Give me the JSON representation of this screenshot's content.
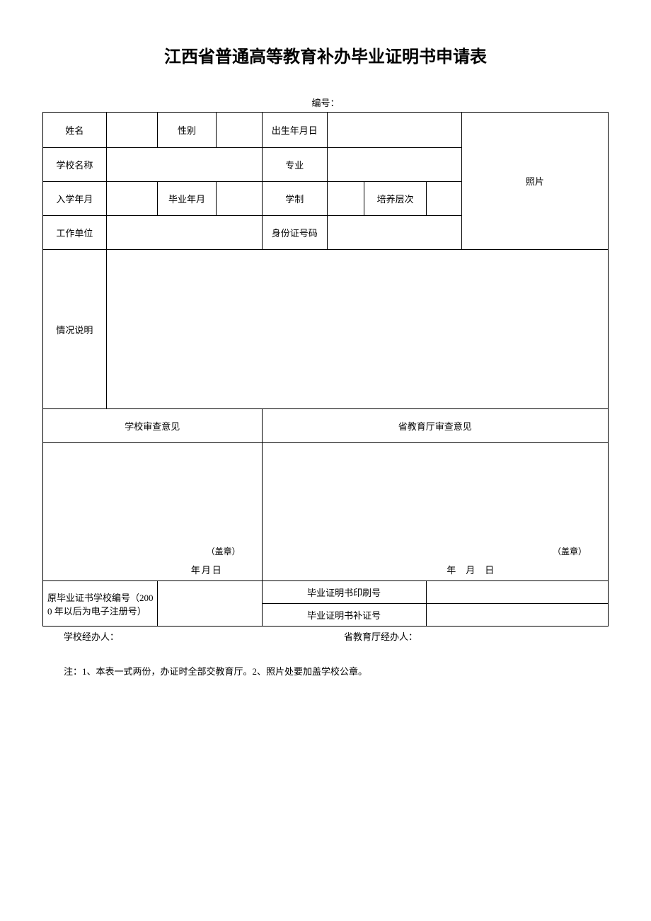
{
  "title": "江西省普通高等教育补办毕业证明书申请表",
  "serialLabel": "编号：",
  "labels": {
    "name": "姓名",
    "gender": "性别",
    "birth": "出生年月日",
    "school": "学校名称",
    "major": "专业",
    "photo": "照片",
    "enroll": "入学年月",
    "gradYM": "毕业年月",
    "system": "学制",
    "level": "培养层次",
    "workUnit": "工作单位",
    "idNum": "身份证号码",
    "explain": "情况说明",
    "schoolOpinion": "学校审查意见",
    "deptOpinion": "省教育厅审查意见",
    "seal": "（盖章）",
    "dateL": "年月日",
    "dateR": "年月日",
    "origNum": "原毕业证书学校编号（2000 年以后为电子注册号）",
    "printNum": "毕业证明书印刷号",
    "suppNum": "毕业证明书补证号",
    "schoolHandler": "学校经办人：",
    "deptHandler": "省教育厅经办人：",
    "note": "注：1、本表一式两份，办证时全部交教育厅。2、照片处要加盖学校公章。"
  }
}
